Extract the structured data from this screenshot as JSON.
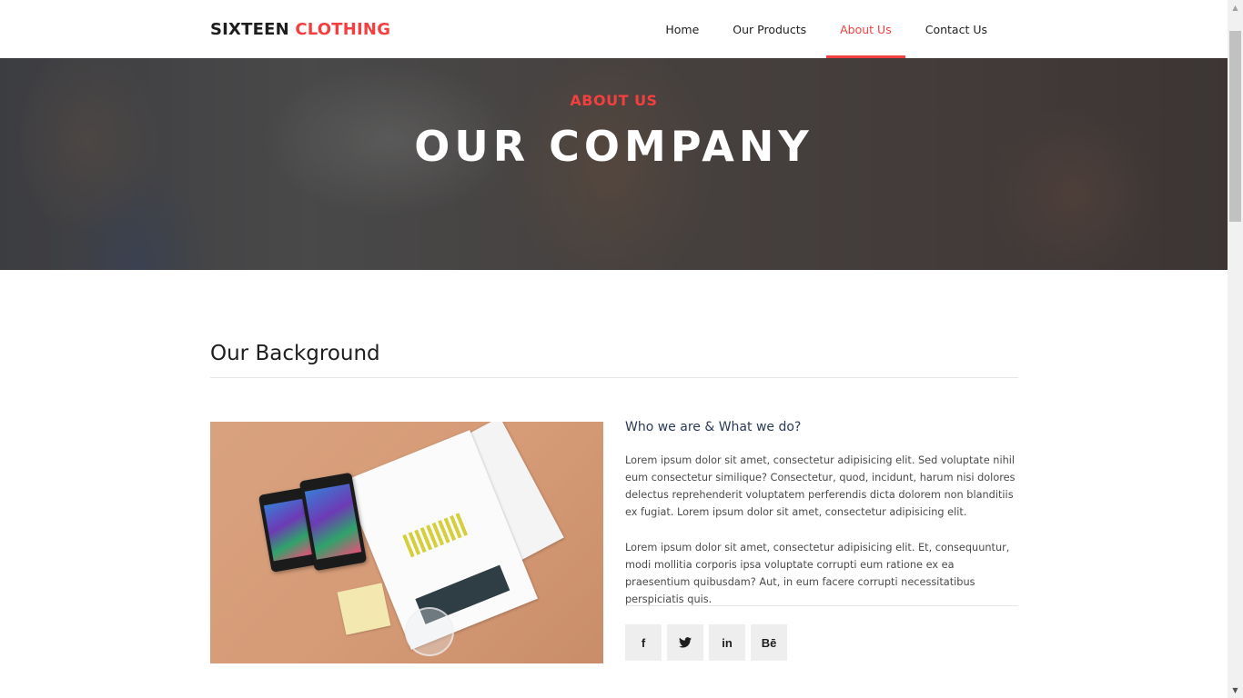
{
  "header": {
    "logo_primary": "SIXTEEN",
    "logo_accent": "CLOTHING",
    "nav": [
      {
        "label": "Home",
        "active": false
      },
      {
        "label": "Our Products",
        "active": false
      },
      {
        "label": "About Us",
        "active": true
      },
      {
        "label": "Contact Us",
        "active": false
      }
    ]
  },
  "hero": {
    "subtitle": "ABOUT US",
    "title": "OUR COMPANY"
  },
  "background_section": {
    "title": "Our Background",
    "subheading": "Who we are & What we do?",
    "paragraph_1": "Lorem ipsum dolor sit amet, consectetur adipisicing elit. Sed voluptate nihil eum consectetur similique? Consectetur, quod, incidunt, harum nisi dolores delectus reprehenderit voluptatem perferendis dicta dolorem non blanditiis ex fugiat. Lorem ipsum dolor sit amet, consectetur adipisicing elit.",
    "paragraph_2": "Lorem ipsum dolor sit amet, consectetur adipisicing elit. Et, consequuntur, modi mollitia corporis ipsa voluptate corrupti eum ratione ex ea praesentium quibusdam? Aut, in eum facere corrupti necessitatibus perspiciatis quis.",
    "social": [
      {
        "label": "f",
        "icon": "facebook-icon"
      },
      {
        "label": "🐦",
        "icon": "twitter-icon"
      },
      {
        "label": "in",
        "icon": "linkedin-icon"
      },
      {
        "label": "Bē",
        "icon": "behance-icon"
      }
    ]
  },
  "colors": {
    "accent": "#f33f3f",
    "subheading": "#2b3a55",
    "text": "#1e1e1e"
  }
}
